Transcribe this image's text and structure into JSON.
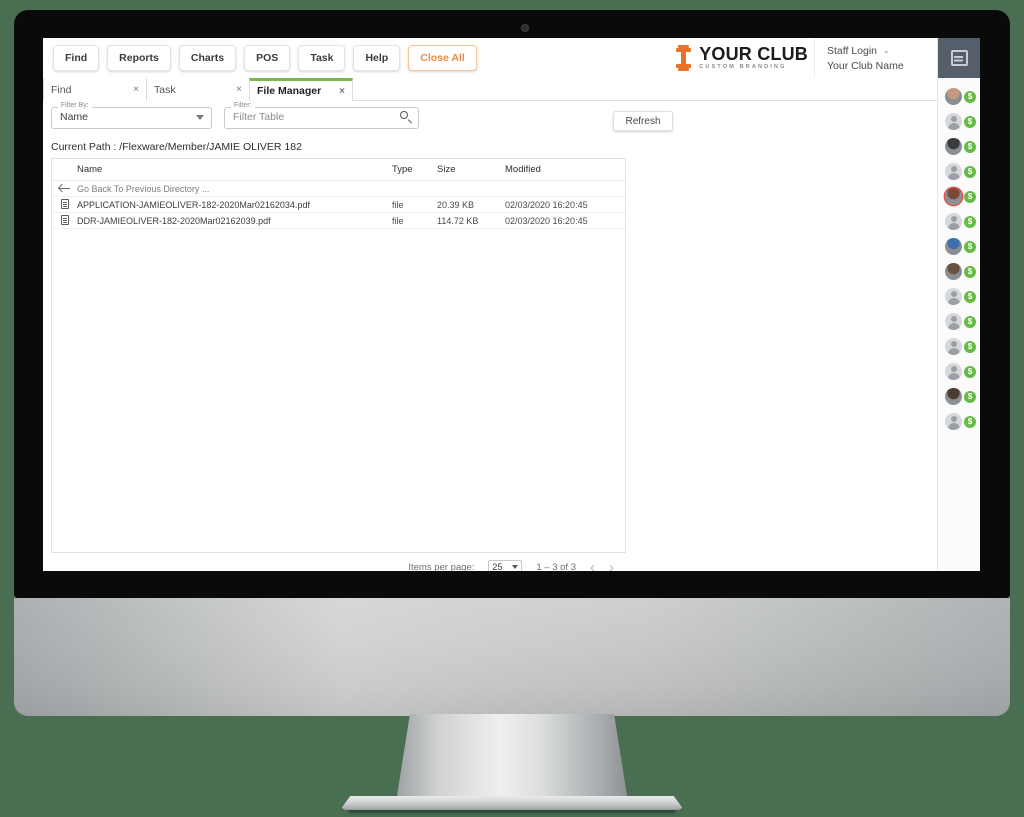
{
  "topbar": {
    "buttons": [
      {
        "label": "Find",
        "name": "menu-button-find"
      },
      {
        "label": "Reports",
        "name": "menu-button-reports"
      },
      {
        "label": "Charts",
        "name": "menu-button-charts"
      },
      {
        "label": "POS",
        "name": "menu-button-pos"
      },
      {
        "label": "Task",
        "name": "menu-button-task"
      },
      {
        "label": "Help",
        "name": "menu-button-help"
      },
      {
        "label": "Close All",
        "name": "menu-button-close-all"
      }
    ],
    "brand": {
      "title": "YOUR CLUB",
      "subtitle": "CUSTOM BRANDING",
      "accent": "#e8722c"
    },
    "account": {
      "login": "Staff Login",
      "club": "Your Club Name",
      "caret": "⌄"
    },
    "list_icon": "list-icon"
  },
  "tabs": [
    {
      "label": "Find",
      "close": "×",
      "active": false
    },
    {
      "label": "Task",
      "close": "×",
      "active": false
    },
    {
      "label": "File Manager",
      "close": "×",
      "active": true
    }
  ],
  "tab_accent": "#7ab648",
  "filters": {
    "filter_by": {
      "label": "Filter By:",
      "value": "Name"
    },
    "filter": {
      "label": "Filter:",
      "placeholder": "Filter Table"
    }
  },
  "refresh_label": "Refresh",
  "current_path": "Current Path : /Flexware/Member/JAMIE OLIVER 182",
  "table": {
    "columns": [
      "Name",
      "Type",
      "Size",
      "Modified"
    ],
    "nav_row": "Go Back To Previous Directory ...",
    "rows": [
      {
        "name": "APPLICATION-JAMIEOLIVER-182-2020Mar02162034.pdf",
        "type": "file",
        "size": "20.39 KB",
        "modified": "02/03/2020 16:20:45"
      },
      {
        "name": "DDR-JAMIEOLIVER-182-2020Mar02162039.pdf",
        "type": "file",
        "size": "114.72 KB",
        "modified": "02/03/2020 16:20:45"
      }
    ]
  },
  "paginator": {
    "items_per_page_label": "Items per page:",
    "items_per_page_value": "25",
    "range_label": "1 – 3 of 3",
    "prev": "‹",
    "next": "›"
  },
  "right_rail": {
    "top_icon": "calendar-icon",
    "badge_symbol": "$",
    "badge_color": "#66bb45",
    "members": [
      {
        "photo": true,
        "ring": false,
        "tone": "#c49a82"
      },
      {
        "photo": false,
        "ring": false,
        "tone": "#d6d8da"
      },
      {
        "photo": true,
        "ring": false,
        "tone": "#3b3b3b"
      },
      {
        "photo": false,
        "ring": false,
        "tone": "#d6d8da"
      },
      {
        "photo": true,
        "ring": true,
        "tone": "#7a4a3a"
      },
      {
        "photo": false,
        "ring": false,
        "tone": "#d6d8da"
      },
      {
        "photo": true,
        "ring": false,
        "tone": "#3f6fa8"
      },
      {
        "photo": true,
        "ring": false,
        "tone": "#6b5140"
      },
      {
        "photo": false,
        "ring": false,
        "tone": "#d6d8da"
      },
      {
        "photo": false,
        "ring": false,
        "tone": "#d6d8da"
      },
      {
        "photo": false,
        "ring": false,
        "tone": "#d6d8da"
      },
      {
        "photo": false,
        "ring": false,
        "tone": "#d6d8da"
      },
      {
        "photo": true,
        "ring": false,
        "tone": "#4a3a30"
      },
      {
        "photo": false,
        "ring": false,
        "tone": "#d6d8da"
      }
    ]
  }
}
